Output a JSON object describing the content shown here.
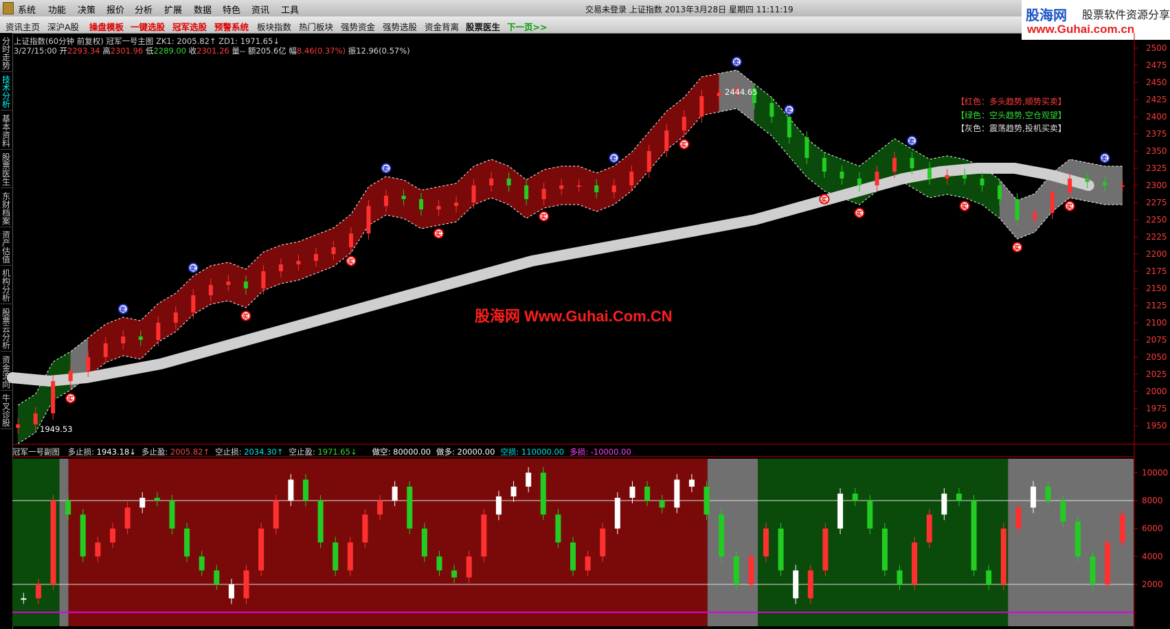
{
  "menubar": {
    "items": [
      "系统",
      "功能",
      "决策",
      "报价",
      "分析",
      "扩展",
      "数据",
      "特色",
      "资讯",
      "工具"
    ],
    "title": "交易未登录  上证指数 2013年3月28日 星期四 11:11:19"
  },
  "toolbar": {
    "items": [
      {
        "label": "资讯主页",
        "style": "normal"
      },
      {
        "label": "深沪A股",
        "style": "normal"
      },
      {
        "label": "操盘模板",
        "style": "red"
      },
      {
        "label": "一键选股",
        "style": "red"
      },
      {
        "label": "冠军选股",
        "style": "red"
      },
      {
        "label": "预警系统",
        "style": "red"
      },
      {
        "label": "板块指数",
        "style": "normal"
      },
      {
        "label": "热门板块",
        "style": "normal"
      },
      {
        "label": "强势资金",
        "style": "normal"
      },
      {
        "label": "强势选股",
        "style": "normal"
      },
      {
        "label": "资金背离",
        "style": "normal"
      },
      {
        "label": "股票医生",
        "style": "bold"
      },
      {
        "label": "下一页>>",
        "style": "green"
      }
    ]
  },
  "banner": {
    "logo": "股海网",
    "share_text": "股票软件资源分享",
    "url": "www.Guhai.com.cn"
  },
  "sidebar": {
    "tabs": [
      "分时走势",
      "技术分析",
      "基本资料",
      "股票医生",
      "东财档案",
      "资产估值",
      "机构分析",
      "股票云分析",
      "资金流向",
      "牛叉诊股"
    ],
    "active": 1
  },
  "main_chart": {
    "info1": "上证指数(60分钟 前复权) 冠军一号主图   ZK1: 2005.82↑  ZD1: 1971.65↓",
    "date": "3/27/15:00",
    "ohlc": [
      {
        "label": "开",
        "value": "2293.34"
      },
      {
        "label": "高",
        "value": "2301.96"
      },
      {
        "label": "低",
        "value": "2289.00"
      },
      {
        "label": "收",
        "value": "2301.26"
      }
    ],
    "vol_text": "量-- 额205.6亿",
    "pct": {
      "label": "幅",
      "value": "8.46(0.37%)"
    },
    "amp": {
      "label": "振",
      "value": "12.96(0.57%)"
    },
    "high_label": "2444.65",
    "low_label": "1949.53",
    "legend": [
      {
        "text": "【红色：多头趋势,顺势买卖】",
        "color": "#ff3c3c"
      },
      {
        "text": "【绿色：空头趋势,空仓观望】",
        "color": "#33dd33"
      },
      {
        "text": "【灰色：震荡趋势,投机买卖】",
        "color": "#e0e0e0"
      }
    ]
  },
  "sub_chart": {
    "name": "冠军一号副图",
    "items": [
      {
        "label": "多止损:",
        "value": "1943.18↓",
        "color": "#ffffff"
      },
      {
        "label": "多止盈:",
        "value": "2005.82↑",
        "color": "#ff4444"
      },
      {
        "label": "空止损:",
        "value": "2034.30↑",
        "color": "#00e5e5"
      },
      {
        "label": "空止盈:",
        "value": "1971.65↓",
        "color": "#33dd33"
      },
      {
        "label": "做空:",
        "value": "80000.00",
        "color": "#ffffff"
      },
      {
        "label": "做多:",
        "value": "20000.00",
        "color": "#ffffff"
      },
      {
        "label": "空损:",
        "value": "110000.00",
        "color": "#00e5e5"
      },
      {
        "label": "多损:",
        "value": "-10000.00",
        "color": "#ff44ff"
      }
    ]
  },
  "watermark": "股海网 Www.Guhai.Com.CN",
  "signals": {
    "buy": "买",
    "sell": "卖"
  },
  "colors": {
    "bull": "#7a0a0a",
    "bear": "#0a4a0a",
    "range": "#707070",
    "up": "#ff3030",
    "down": "#22cc22",
    "white": "#ffffff",
    "cyan": "#00e5e5"
  },
  "chart_data": [
    {
      "type": "line",
      "title": "上证指数(60分钟 前复权) 冠军一号主图",
      "ylim": [
        1925,
        2510
      ],
      "yticks": [
        1950,
        1975,
        2000,
        2025,
        2050,
        2075,
        2100,
        2125,
        2150,
        2175,
        2200,
        2225,
        2250,
        2275,
        2300,
        2325,
        2350,
        2375,
        2400,
        2425,
        2450,
        2475,
        2500
      ],
      "series": [
        {
          "name": "close",
          "values": [
            1952,
            1968,
            2015,
            2030,
            2050,
            2070,
            2080,
            2075,
            2100,
            2115,
            2140,
            2155,
            2160,
            2150,
            2175,
            2185,
            2190,
            2200,
            2210,
            2230,
            2270,
            2285,
            2280,
            2265,
            2270,
            2275,
            2300,
            2310,
            2300,
            2280,
            2295,
            2300,
            2300,
            2290,
            2300,
            2320,
            2350,
            2380,
            2400,
            2430,
            2435,
            2440,
            2420,
            2400,
            2370,
            2340,
            2320,
            2310,
            2300,
            2320,
            2340,
            2325,
            2310,
            2315,
            2310,
            2300,
            2280,
            2250,
            2260,
            2290,
            2310,
            2305,
            2300,
            2300
          ],
          "x_extent": [
            0,
            1
          ]
        },
        {
          "name": "trend",
          "values": [
            2020,
            2015,
            2020,
            2030,
            2040,
            2055,
            2070,
            2085,
            2100,
            2115,
            2130,
            2145,
            2160,
            2175,
            2190,
            2200,
            2210,
            2220,
            2230,
            2240,
            2250,
            2265,
            2280,
            2295,
            2310,
            2320,
            2325,
            2325,
            2315,
            2300
          ],
          "x_extent": [
            0,
            0.96
          ]
        }
      ],
      "bands": [
        {
          "trend": "bear",
          "from": 0,
          "to": 0.042
        },
        {
          "trend": "range",
          "from": 0.042,
          "to": 0.05
        },
        {
          "trend": "bull",
          "from": 0.05,
          "to": 0.62
        },
        {
          "trend": "range",
          "from": 0.62,
          "to": 0.665
        },
        {
          "trend": "bear",
          "from": 0.665,
          "to": 0.888
        },
        {
          "trend": "range",
          "from": 0.888,
          "to": 1
        }
      ]
    },
    {
      "type": "bar",
      "title": "冠军一号副图",
      "ylim": [
        -1000,
        11000
      ],
      "yticks": [
        2000,
        4000,
        6000,
        8000,
        10000
      ],
      "reference_lines": [
        2000,
        8000,
        0
      ],
      "series": [
        {
          "name": "oscillator",
          "values": [
            1000,
            2000,
            8000,
            7000,
            4000,
            5000,
            6000,
            7500,
            8200,
            8000,
            6000,
            4000,
            3000,
            2000,
            1000,
            3000,
            6000,
            8000,
            9500,
            8000,
            5000,
            3000,
            5000,
            7000,
            8000,
            9000,
            6000,
            4000,
            3000,
            2500,
            4000,
            7000,
            8300,
            9000,
            10000,
            7000,
            5000,
            3000,
            4000,
            6000,
            8200,
            9000,
            8000,
            7500,
            9500,
            9000,
            7000,
            4000,
            2000,
            4000,
            6000,
            3000,
            1000,
            3000,
            6000,
            8500,
            8000,
            6000,
            3000,
            2000,
            5000,
            7000,
            8500,
            8000,
            3000,
            2000,
            6000,
            7500,
            9000,
            8000,
            6500,
            4000,
            2000,
            5000,
            7000
          ]
        }
      ]
    }
  ]
}
